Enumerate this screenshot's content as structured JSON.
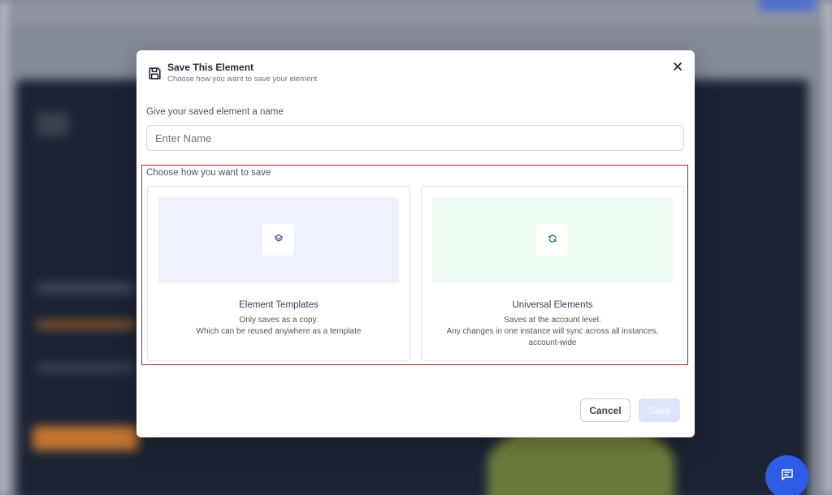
{
  "modal": {
    "title": "Save This Element",
    "subtitle": "Choose how you want to save your element",
    "name_label": "Give your saved element a name",
    "name_placeholder": "Enter Name",
    "name_value": "",
    "choose_label": "Choose how you want to save",
    "options": [
      {
        "title": "Element Templates",
        "description_line1": "Only saves as a copy.",
        "description_line2": "Which can be reused anywhere as a template",
        "icon": "layers-icon",
        "color": "#eef2fd",
        "icon_color": "#3b3f8f"
      },
      {
        "title": "Universal Elements",
        "description_line1": "Saves at the account level.",
        "description_line2": "Any changes in one instance will sync across all instances, account-wide",
        "icon": "sync-icon",
        "color": "#eefcf1",
        "icon_color": "#2e7d4f"
      }
    ],
    "cancel_label": "Cancel",
    "save_label": "Save"
  },
  "colors": {
    "accent": "#2f5ce6",
    "selection_border": "#b4232a"
  },
  "icons": {
    "header": "save-icon",
    "close": "close-icon",
    "chat": "chat-icon"
  }
}
